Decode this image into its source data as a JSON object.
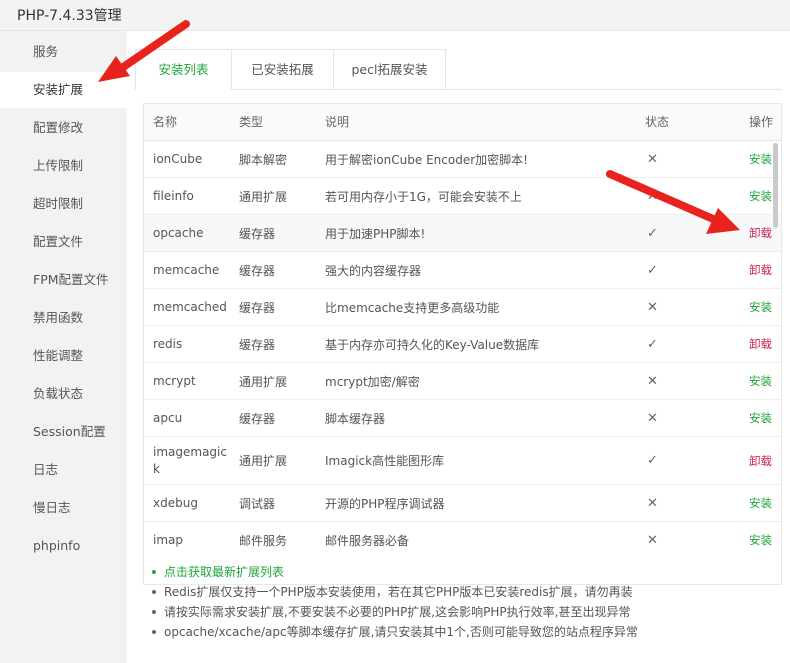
{
  "window": {
    "title": "PHP-7.4.33管理"
  },
  "sidebar": {
    "items": [
      {
        "label": "服务"
      },
      {
        "label": "安装扩展"
      },
      {
        "label": "配置修改"
      },
      {
        "label": "上传限制"
      },
      {
        "label": "超时限制"
      },
      {
        "label": "配置文件"
      },
      {
        "label": "FPM配置文件"
      },
      {
        "label": "禁用函数"
      },
      {
        "label": "性能调整"
      },
      {
        "label": "负载状态"
      },
      {
        "label": "Session配置"
      },
      {
        "label": "日志"
      },
      {
        "label": "慢日志"
      },
      {
        "label": "phpinfo"
      }
    ],
    "active_index": 1
  },
  "tabs": [
    {
      "label": "安装列表"
    },
    {
      "label": "已安装拓展"
    },
    {
      "label": "pecl拓展安装"
    }
  ],
  "table": {
    "headers": {
      "name": "名称",
      "type": "类型",
      "desc": "说明",
      "status": "状态",
      "action": "操作"
    },
    "rows": [
      {
        "name": "ionCube",
        "type": "脚本解密",
        "desc": "用于解密ionCube Encoder加密脚本!",
        "installed": false,
        "action": "安装"
      },
      {
        "name": "fileinfo",
        "type": "通用扩展",
        "desc": "若可用内存小于1G，可能会安装不上",
        "installed": false,
        "action": "安装"
      },
      {
        "name": "opcache",
        "type": "缓存器",
        "desc": "用于加速PHP脚本!",
        "installed": true,
        "action": "卸载"
      },
      {
        "name": "memcache",
        "type": "缓存器",
        "desc": "强大的内容缓存器",
        "installed": true,
        "action": "卸载"
      },
      {
        "name": "memcached",
        "type": "缓存器",
        "desc": "比memcache支持更多高级功能",
        "installed": false,
        "action": "安装"
      },
      {
        "name": "redis",
        "type": "缓存器",
        "desc": "基于内存亦可持久化的Key-Value数据库",
        "installed": true,
        "action": "卸载"
      },
      {
        "name": "mcrypt",
        "type": "通用扩展",
        "desc": "mcrypt加密/解密",
        "installed": false,
        "action": "安装"
      },
      {
        "name": "apcu",
        "type": "缓存器",
        "desc": "脚本缓存器",
        "installed": false,
        "action": "安装"
      },
      {
        "name_line1": "imagemagic",
        "name_line2": "k",
        "type": "通用扩展",
        "desc": "Imagick高性能图形库",
        "installed": true,
        "action": "卸载"
      },
      {
        "name": "xdebug",
        "type": "调试器",
        "desc": "开源的PHP程序调试器",
        "installed": false,
        "action": "安装"
      },
      {
        "name": "imap",
        "type": "邮件服务",
        "desc": "邮件服务器必备",
        "installed": false,
        "action": "安装"
      }
    ]
  },
  "icons": {
    "installed": "check-icon",
    "not_installed": "cross-icon"
  },
  "notes": {
    "link": "点击获取最新扩展列表",
    "items": [
      "Redis扩展仅支持一个PHP版本安装使用，若在其它PHP版本已安装redis扩展，请勿再装",
      "请按实际需求安装扩展,不要安装不必要的PHP扩展,这会影响PHP执行效率,甚至出现异常",
      "opcache/xcache/apc等脚本缓存扩展,请只安装其中1个,否则可能导致您的站点程序异常"
    ]
  },
  "colors": {
    "accent": "#20a53a",
    "danger": "#c7254e",
    "annotation": "#e8231e"
  }
}
